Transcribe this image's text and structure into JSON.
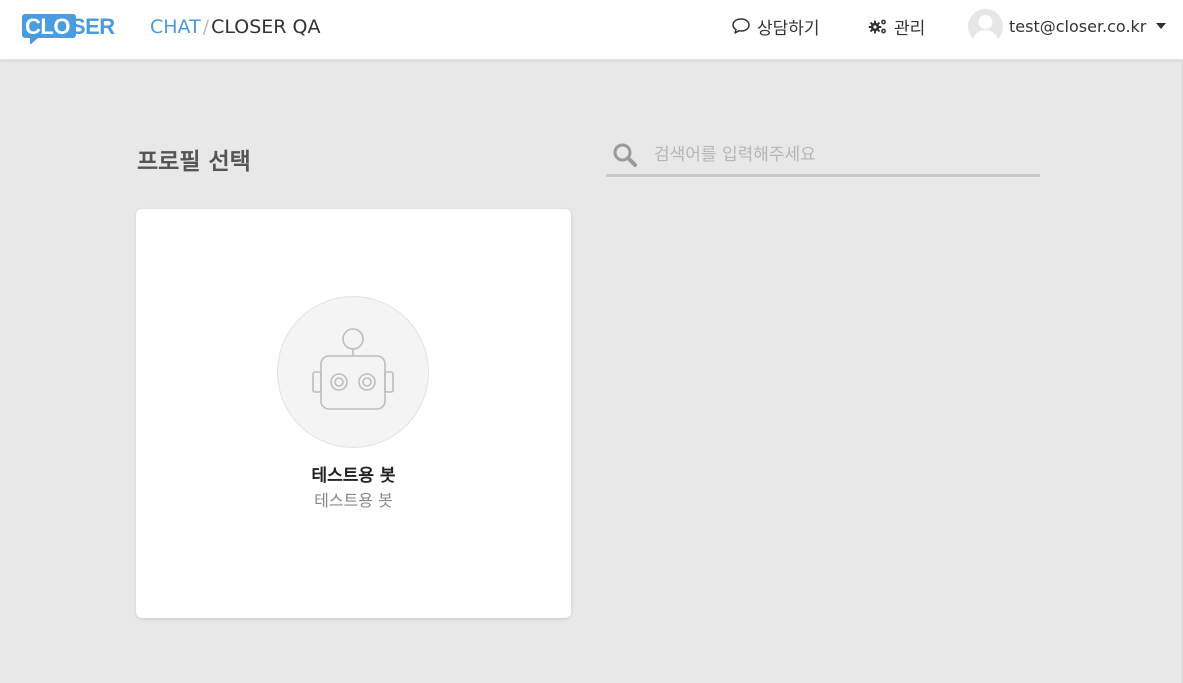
{
  "header": {
    "logo_text": "CLOSER",
    "breadcrumb": {
      "parent": "CHAT",
      "separator": "/",
      "current": "CLOSER QA"
    },
    "nav": {
      "consult_label": "상담하기",
      "consult_icon": "chat-bubble-icon",
      "admin_label": "관리",
      "admin_icon": "gears-icon"
    },
    "user": {
      "email": "test@closer.co.kr",
      "avatar_icon": "user-silhouette-icon",
      "menu_icon": "caret-down-icon"
    }
  },
  "main": {
    "title": "프로필 선택",
    "search": {
      "placeholder": "검색어를 입력해주세요",
      "value": "",
      "icon": "search-icon"
    },
    "profiles": [
      {
        "name": "테스트용 봇",
        "description": "테스트용 봇",
        "icon": "robot-icon"
      }
    ]
  },
  "colors": {
    "brand_blue": "#4a9be0",
    "background": "#e8e8e8",
    "card": "#ffffff"
  }
}
